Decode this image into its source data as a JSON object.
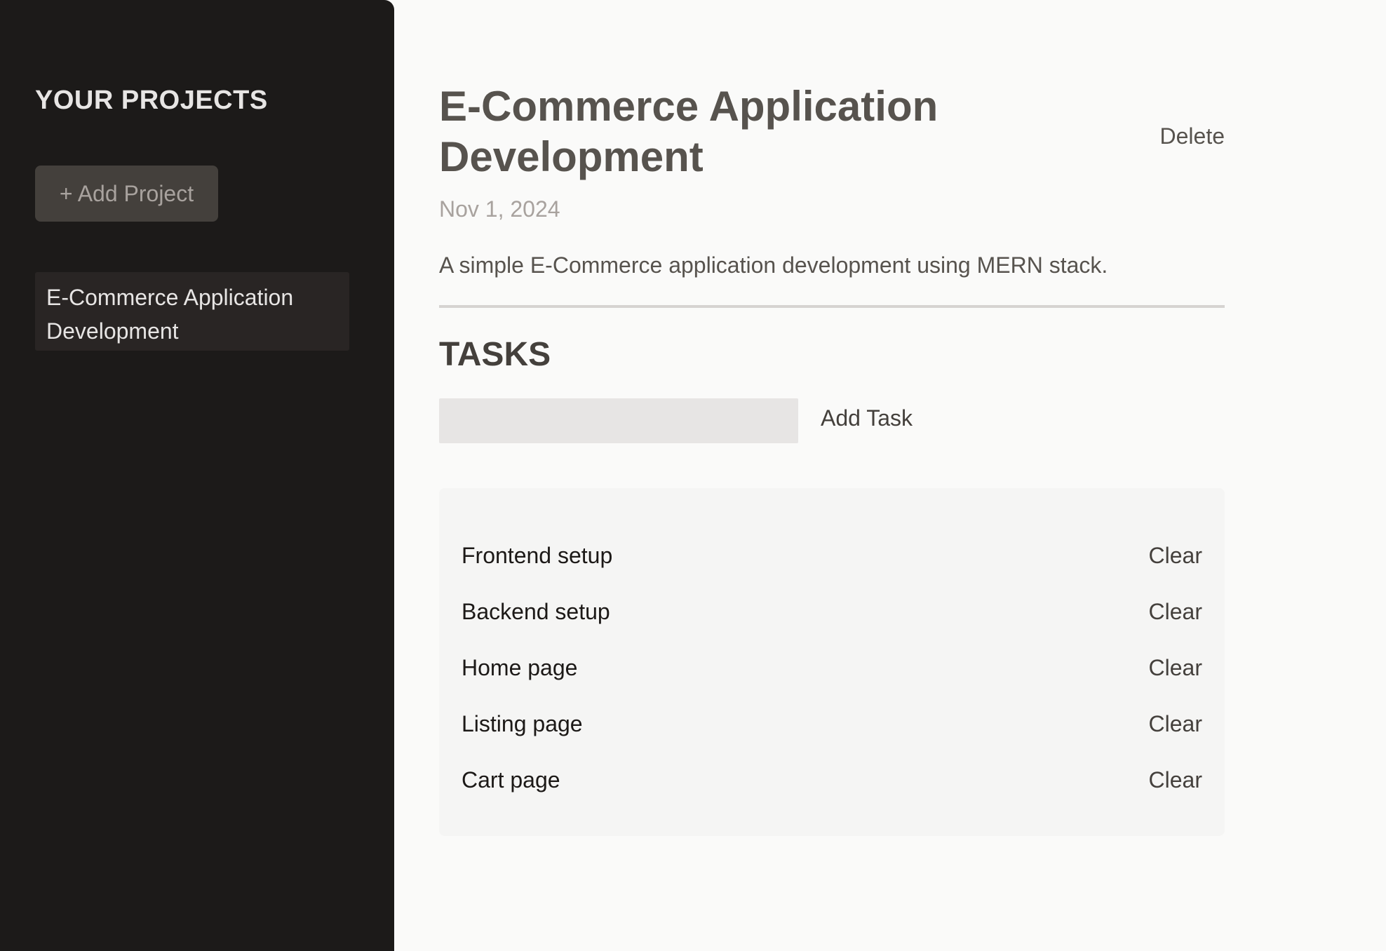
{
  "sidebar": {
    "title": "YOUR PROJECTS",
    "add_project_label": "+ Add Project",
    "projects": [
      {
        "label": "E-Commerce Application Development"
      }
    ]
  },
  "project": {
    "title": "E-Commerce Application Development",
    "delete_label": "Delete",
    "date": "Nov 1, 2024",
    "description": "A simple E-Commerce application development using MERN stack."
  },
  "tasks": {
    "heading": "TASKS",
    "input_value": "",
    "add_label": "Add Task",
    "clear_label": "Clear",
    "items": [
      {
        "name": "Frontend setup"
      },
      {
        "name": "Backend setup"
      },
      {
        "name": "Home page"
      },
      {
        "name": "Listing page"
      },
      {
        "name": "Cart page"
      }
    ]
  },
  "colors": {
    "sidebar_bg": "#1c1a19",
    "main_bg": "#fafaf9",
    "accent_button_bg": "#44403c",
    "task_panel_bg": "#f5f5f4"
  }
}
